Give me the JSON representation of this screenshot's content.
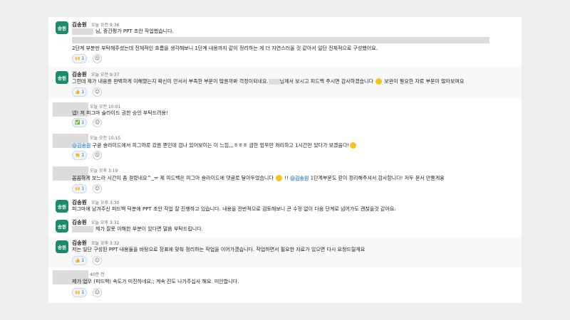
{
  "avatar_label": "송원",
  "messages": [
    {
      "author": "김송원",
      "time": "오늘 오전 9:36",
      "line1": "님, 중간평가 PPT 초안 작업했습니다.",
      "line2": "2단계 부분만 부탁해주셨는데 전체적인 흐름을 생각해보니 1단계 내용까지 같이 정리하는 게 더 자연스러울 것 같아서 일단 전체적으로 구성했어요.",
      "reaction": "🙌 1"
    },
    {
      "author": "김송원",
      "time": "오늘 오전 9:37",
      "line1a": "그런데 제가 내용을 완벽하게 이해했는지 확신이 안서서 부족한 부분이 많을까봐 걱정이되네요.",
      "line1b": "님께서 보시고 피드백 주시면 감사하겠습니다",
      "line1c": "보완이 필요한 자료 부분이 많아보여요",
      "reaction": "👍 1"
    },
    {
      "time": "오늘 오전 10:01",
      "line1": "넵! 저 피그마 슬라이드 권한 승인 부탁드려용!",
      "reaction": "✅ 1"
    },
    {
      "time": "오늘 오전 10:15",
      "mention": "@김송원",
      "line1": " 구글 슬라이드에서 피그마로 갔을 뿐인데 겁나 있어보이는 이 느낌,,,ㅎㅎㅎ 급한 업무만 처리하고 1시간만 있다가 보겠읍다!",
      "reaction": "👏 1"
    },
    {
      "time": "오늘 오후 3:19",
      "line1a": "꼼꼼하게 보느라 시간이 좀 걸렸네요^_ㅠ 제 피드백은 피그마 슬라이드에 댓글로 달아두었습니다",
      "line1b": " !! ",
      "mention": "@김송원",
      "line1c": " 1단계부분도 같이 정리해주셔서 감사합니다! 저두 문서 만들게용",
      "reaction": "🙌 1"
    },
    {
      "author": "김송원",
      "time": "오늘 오후 3:30",
      "line1": "피그마에 남겨주신 피드백 덕분에 PPT 초안 작업 잘 진행하고 있습니다. 내용을 전반적으로 검토해보니 큰 수정 없이 다음 단계로 넘어가도 괜찮을것 같아요."
    },
    {
      "author": "김송원",
      "time": "오늘 오후 3:31",
      "line1": "제가 잘못 이해한 부분이 있다면 말씀 부탁드립니다."
    },
    {
      "author": "김송원",
      "time": "오늘 오후 3:32",
      "line1": "저는 일단 구성된 PPT 내용들을 바탕으로 장표에 맞춰 정리하는 작업을 이어가겠습니다. 작업하면서 필요한 자료가 있으면 다시 요청드릴게요",
      "reaction": "👍 1"
    },
    {
      "time": "40분 전",
      "line1": "제가 업무 (피드백) 속도가 미진하네요;; 계속 진도 나가주십사 해요. 미안합니다.",
      "reaction": "🙌 1"
    }
  ]
}
